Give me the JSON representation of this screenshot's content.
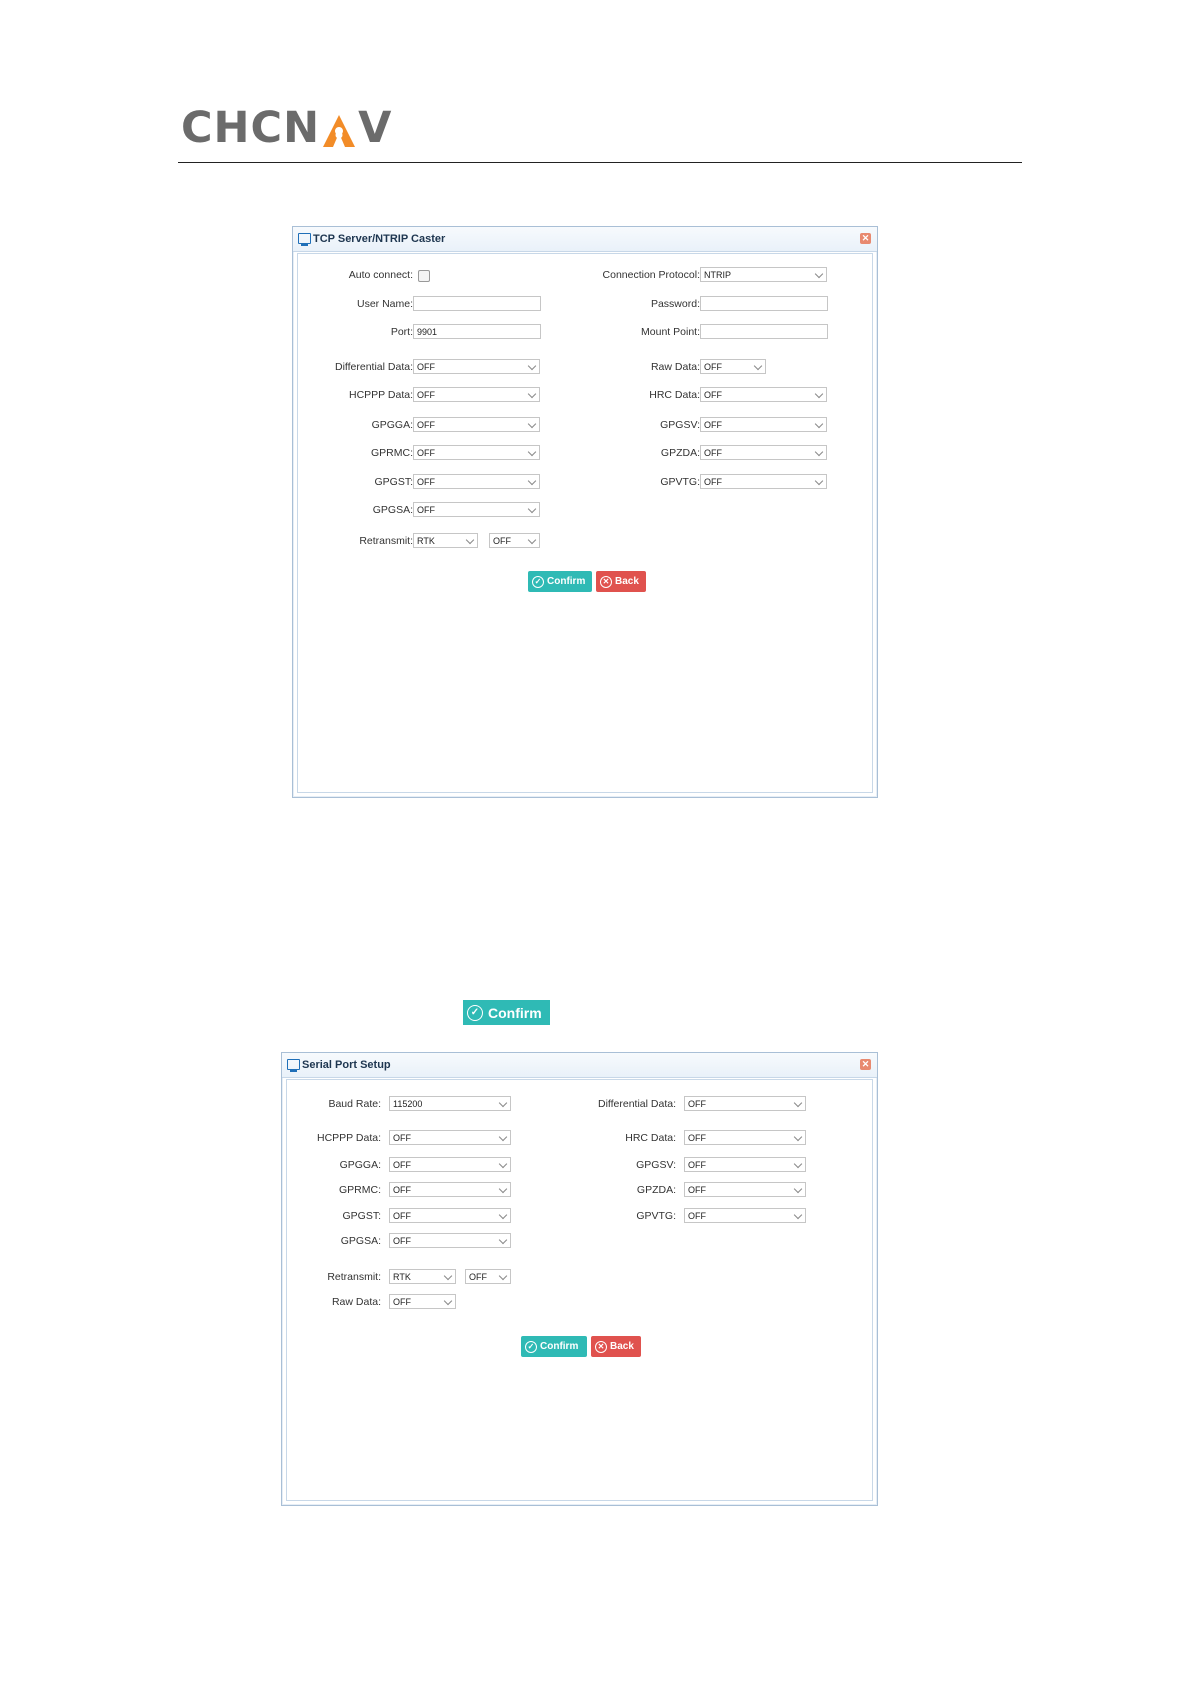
{
  "logo": {
    "text_left": "CHCN",
    "text_right": "V",
    "accent_color": "#f28c28",
    "gray_color": "#6b6b6b"
  },
  "tcp": {
    "title": "TCP Server/NTRIP Caster",
    "close_icon": "close-icon",
    "auto_connect_label": "Auto connect:",
    "connection_protocol_label": "Connection Protocol:",
    "connection_protocol_value": "NTRIP",
    "user_name_label": "User Name:",
    "user_name_value": "",
    "password_label": "Password:",
    "password_value": "",
    "port_label": "Port:",
    "port_value": "9901",
    "mount_point_label": "Mount Point:",
    "mount_point_value": "",
    "differential_data_label": "Differential Data:",
    "differential_data_value": "OFF",
    "raw_data_label": "Raw Data:",
    "raw_data_value": "OFF",
    "hcppp_label": "HCPPP Data:",
    "hcppp_value": "OFF",
    "hrc_label": "HRC Data:",
    "hrc_value": "OFF",
    "gpgga_label": "GPGGA:",
    "gpgga_value": "OFF",
    "gpgsv_label": "GPGSV:",
    "gpgsv_value": "OFF",
    "gprmc_label": "GPRMC:",
    "gprmc_value": "OFF",
    "gpzda_label": "GPZDA:",
    "gpzda_value": "OFF",
    "gpgst_label": "GPGST:",
    "gpgst_value": "OFF",
    "gpvtg_label": "GPVTG:",
    "gpvtg_value": "OFF",
    "gpgsa_label": "GPGSA:",
    "gpgsa_value": "OFF",
    "retransmit_label": "Retransmit:",
    "retransmit_type": "RTK",
    "retransmit_value": "OFF",
    "confirm_label": "Confirm",
    "back_label": "Back"
  },
  "standalone_confirm_label": "Confirm",
  "serial": {
    "title": "Serial Port Setup",
    "baud_rate_label": "Baud Rate:",
    "baud_rate_value": "115200",
    "differential_data_label": "Differential Data:",
    "differential_data_value": "OFF",
    "hcppp_label": "HCPPP Data:",
    "hcppp_value": "OFF",
    "hrc_label": "HRC Data:",
    "hrc_value": "OFF",
    "gpgga_label": "GPGGA:",
    "gpgga_value": "OFF",
    "gpgsv_label": "GPGSV:",
    "gpgsv_value": "OFF",
    "gprmc_label": "GPRMC:",
    "gprmc_value": "OFF",
    "gpzda_label": "GPZDA:",
    "gpzda_value": "OFF",
    "gpgst_label": "GPGST:",
    "gpgst_value": "OFF",
    "gpvtg_label": "GPVTG:",
    "gpvtg_value": "OFF",
    "gpgsa_label": "GPGSA:",
    "gpgsa_value": "OFF",
    "retransmit_label": "Retransmit:",
    "retransmit_type": "RTK",
    "retransmit_value": "OFF",
    "raw_data_label": "Raw Data:",
    "raw_data_value": "OFF",
    "confirm_label": "Confirm",
    "back_label": "Back"
  }
}
